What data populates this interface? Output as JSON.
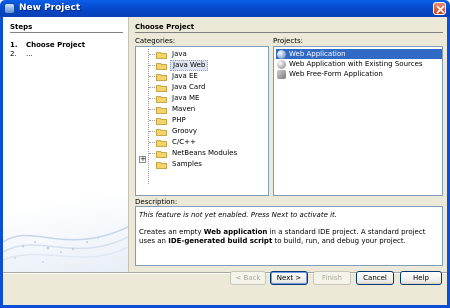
{
  "window": {
    "title": "New Project"
  },
  "steps": {
    "header": "Steps",
    "items": [
      {
        "num": "1.",
        "label": "Choose Project"
      },
      {
        "num": "2.",
        "label": "..."
      }
    ]
  },
  "main": {
    "header": "Choose Project",
    "categories_label": "Categories:",
    "projects_label": "Projects:",
    "categories": [
      {
        "label": "Java"
      },
      {
        "label": "Java Web"
      },
      {
        "label": "Java EE"
      },
      {
        "label": "Java Card"
      },
      {
        "label": "Java ME"
      },
      {
        "label": "Maven"
      },
      {
        "label": "PHP"
      },
      {
        "label": "Groovy"
      },
      {
        "label": "C/C++"
      },
      {
        "label": "NetBeans Modules"
      },
      {
        "label": "Samples",
        "expander": "+"
      }
    ],
    "selected_category": "Java Web",
    "projects": [
      {
        "label": "Web Application",
        "icon": "globe-icon"
      },
      {
        "label": "Web Application with Existing Sources",
        "icon": "globe-icon"
      },
      {
        "label": "Web Free-Form Application",
        "icon": "freeform-icon"
      }
    ],
    "selected_project": "Web Application",
    "description_label": "Description:",
    "description": {
      "notice": "This feature is not yet enabled. Press Next to activate it.",
      "p1": "Creates an empty ",
      "p1_bold": "Web application",
      "p2": " in a standard IDE project. A standard project uses an ",
      "p2_bold": "IDE-generated build script",
      "p3": " to build, run, and debug your project."
    }
  },
  "buttons": {
    "back": "< Back",
    "next": "Next >",
    "finish": "Finish",
    "cancel": "Cancel",
    "help": "Help"
  },
  "colors": {
    "titlebar": "#0548c9",
    "selection": "#316ac5",
    "folder": "#f5d36b"
  }
}
